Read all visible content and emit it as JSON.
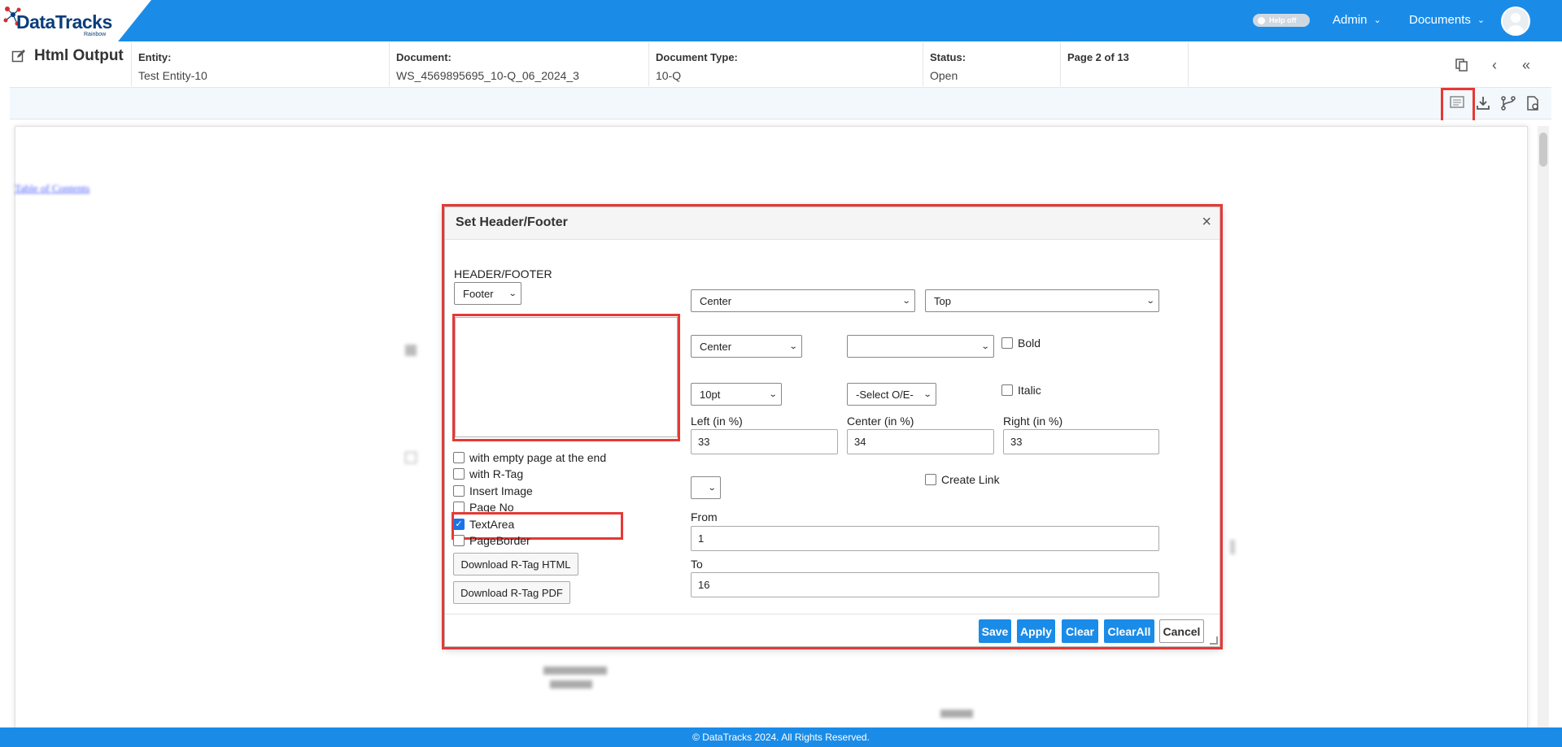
{
  "brand": {
    "logo": "DataTracks",
    "sub": "Rainbow"
  },
  "topnav": {
    "help_toggle": "Help off",
    "admin": "Admin",
    "documents": "Documents"
  },
  "page": {
    "title": "Html Output"
  },
  "info": {
    "entity_label": "Entity:",
    "entity_value": "Test Entity-10",
    "document_label": "Document:",
    "document_value": "WS_4569895695_10-Q_06_2024_3",
    "doctype_label": "Document Type:",
    "doctype_value": "10-Q",
    "status_label": "Status:",
    "status_value": "Open",
    "page_label": "Page 2 of 13"
  },
  "document": {
    "toc_link": "Table of Contents"
  },
  "modal": {
    "title": "Set Header/Footer",
    "close": "×",
    "section_label": "HEADER/FOOTER",
    "type_select": "Footer",
    "align_select": "Center",
    "position_select": "Top",
    "text_align_select": "Center",
    "font_select": "",
    "bold_label": "Bold",
    "size_select": "10pt",
    "oe_select": "-Select O/E-",
    "italic_label": "Italic",
    "left_label": "Left (in %)",
    "left_value": "33",
    "center_label": "Center (in %)",
    "center_value": "34",
    "right_label": "Right (in %)",
    "right_value": "33",
    "small_select": "",
    "create_link_label": "Create Link",
    "from_label": "From",
    "from_value": "1",
    "to_label": "To",
    "to_value": "16",
    "checkboxes": [
      {
        "label": "with empty page at the end",
        "checked": false
      },
      {
        "label": "with R-Tag",
        "checked": false
      },
      {
        "label": "Insert Image",
        "checked": false
      },
      {
        "label": "Page No",
        "checked": false
      },
      {
        "label": "TextArea",
        "checked": true
      },
      {
        "label": "PageBorder",
        "checked": false
      }
    ],
    "download_html": "Download R-Tag HTML",
    "download_pdf": "Download R-Tag PDF",
    "buttons": {
      "save": "Save",
      "apply": "Apply",
      "clear": "Clear",
      "clear_all": "ClearAll",
      "cancel": "Cancel"
    }
  },
  "footer": {
    "copyright": "© DataTracks 2024. All Rights Reserved."
  },
  "colors": {
    "primary": "#1a8ce8",
    "highlight": "#e53935",
    "logo": "#0b3d7a"
  }
}
